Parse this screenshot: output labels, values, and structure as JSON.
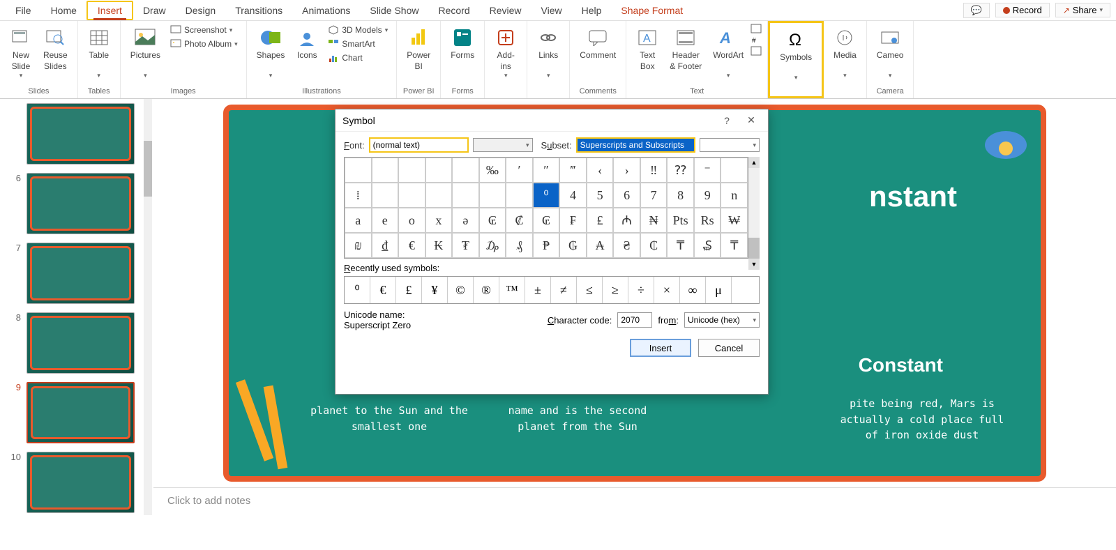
{
  "menu": {
    "tabs": [
      "File",
      "Home",
      "Insert",
      "Draw",
      "Design",
      "Transitions",
      "Animations",
      "Slide Show",
      "Record",
      "Review",
      "View",
      "Help",
      "Shape Format"
    ],
    "active": 2,
    "comment": "💬",
    "record": "Record",
    "share": "Share"
  },
  "ribbon": {
    "slides": {
      "label": "Slides",
      "new_slide": "New\nSlide",
      "reuse": "Reuse\nSlides"
    },
    "tables": {
      "label": "Tables",
      "table": "Table"
    },
    "images": {
      "label": "Images",
      "pictures": "Pictures",
      "screenshot": "Screenshot",
      "photo_album": "Photo Album"
    },
    "illustrations": {
      "label": "Illustrations",
      "shapes": "Shapes",
      "icons": "Icons",
      "models": "3D Models",
      "smartart": "SmartArt",
      "chart": "Chart"
    },
    "powerbi": {
      "label": "Power BI",
      "btn": "Power\nBI"
    },
    "forms": {
      "label": "Forms",
      "btn": "Forms"
    },
    "addins": {
      "label": "",
      "btn": "Add-\nins"
    },
    "links": {
      "label": "",
      "btn": "Links"
    },
    "comments": {
      "label": "Comments",
      "btn": "Comment"
    },
    "text": {
      "label": "Text",
      "text_box": "Text\nBox",
      "header_footer": "Header\n& Footer",
      "wordart": "WordArt"
    },
    "symbols": {
      "label": "",
      "btn": "Symbols"
    },
    "media": {
      "label": "",
      "btn": "Media"
    },
    "camera": {
      "label": "Camera",
      "btn": "Cameo"
    }
  },
  "slide_nums": [
    "",
    "6",
    "7",
    "8",
    "9",
    "10"
  ],
  "slide_canvas": {
    "title_visible": "nstant",
    "constant": "Constant",
    "text1": "planet to the Sun and the smallest one",
    "text2": "name and is the second planet from the Sun",
    "text3": "pite being red, Mars is actually a cold place full of iron oxide dust"
  },
  "notes": {
    "placeholder": "Click to add notes"
  },
  "dialog": {
    "title": "Symbol",
    "font_label": "Font:",
    "font_value": "(normal text)",
    "subset_label": "Subset:",
    "subset_value": "Superscripts and Subscripts",
    "grid": [
      [
        "",
        "",
        "",
        "",
        "",
        "‰",
        "′",
        "″",
        "‴",
        "‹",
        "›",
        "‼",
        "⁇",
        "⁻",
        ""
      ],
      [
        "⁞",
        "",
        "",
        "",
        "",
        "",
        "",
        "⁰",
        "4",
        "5",
        "6",
        "7",
        "8",
        "9",
        "n"
      ],
      [
        "a",
        "e",
        "o",
        "x",
        "ə",
        "₢",
        "₡",
        "₢",
        "₣",
        "₤",
        "₼",
        "₦",
        "Pts",
        "Rs",
        "₩"
      ],
      [
        "₪",
        "₫",
        "€",
        "₭",
        "₮",
        "₯",
        "₰",
        "₱",
        "₲",
        "₳",
        "₴",
        "₵",
        "₸",
        "₷",
        "₸"
      ]
    ],
    "selected_row": 1,
    "selected_col": 7,
    "recent_label": "Recently used symbols:",
    "recent": [
      "⁰",
      "€",
      "£",
      "¥",
      "©",
      "®",
      "™",
      "±",
      "≠",
      "≤",
      "≥",
      "÷",
      "×",
      "∞",
      "μ"
    ],
    "unicode_name_label": "Unicode name:",
    "unicode_name": "Superscript Zero",
    "char_code_label": "Character code:",
    "char_code": "2070",
    "from_label": "from:",
    "from_value": "Unicode (hex)",
    "insert": "Insert",
    "cancel": "Cancel"
  }
}
